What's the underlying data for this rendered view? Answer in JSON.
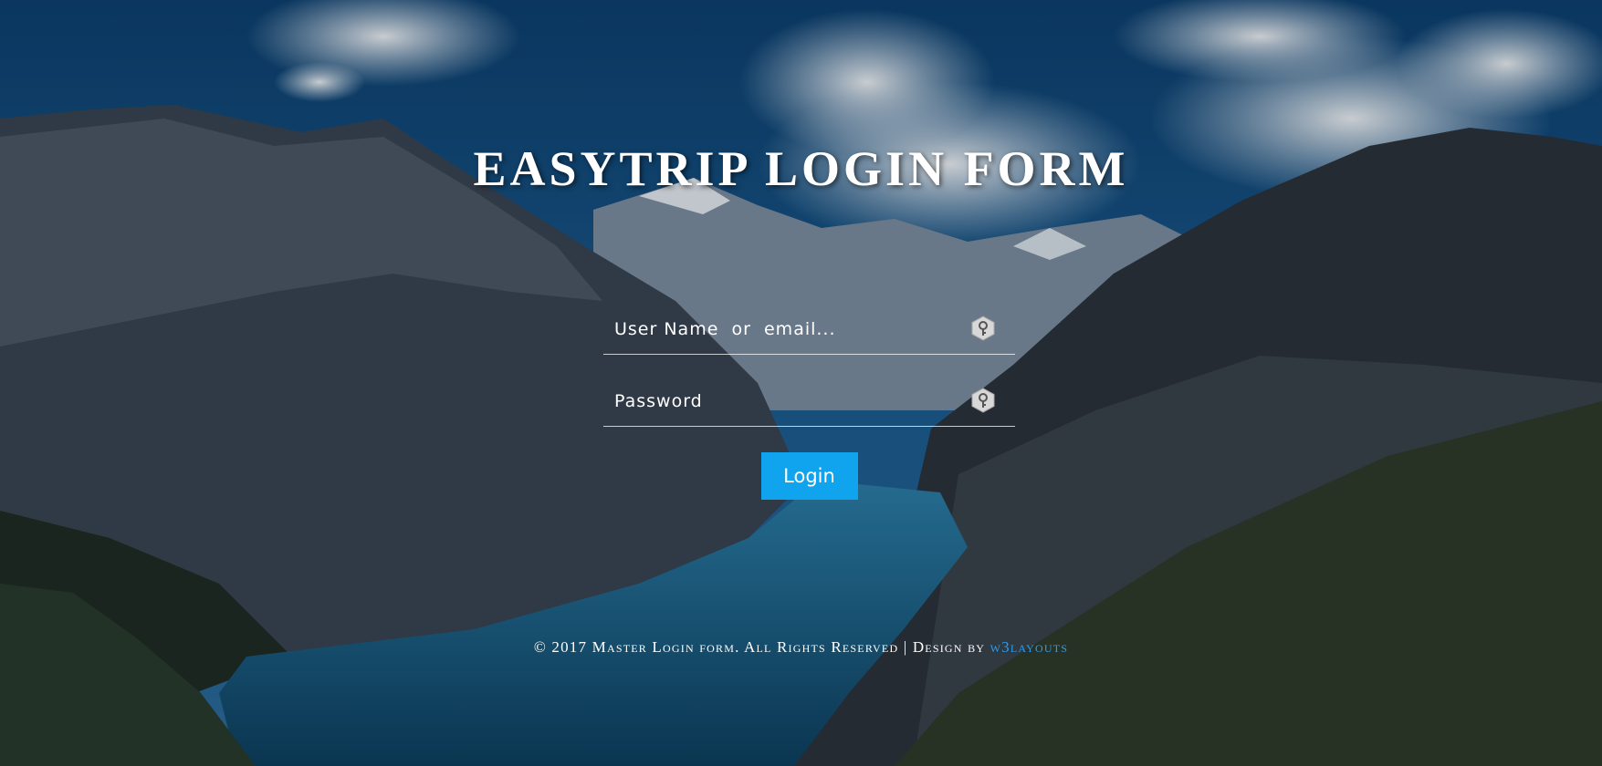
{
  "page": {
    "title": "EASYTRIP LOGIN FORM"
  },
  "form": {
    "username_placeholder": "User Name  or  email...",
    "password_placeholder": "Password",
    "login_label": "Login"
  },
  "icons": {
    "username": "key-icon",
    "password": "key-icon"
  },
  "footer": {
    "text": "© 2017 Master Login form. All Rights Reserved | Design by",
    "link_text": "w3layouts"
  },
  "colors": {
    "button": "#10a3ee",
    "link": "#2a9df4",
    "text": "#ffffff"
  }
}
